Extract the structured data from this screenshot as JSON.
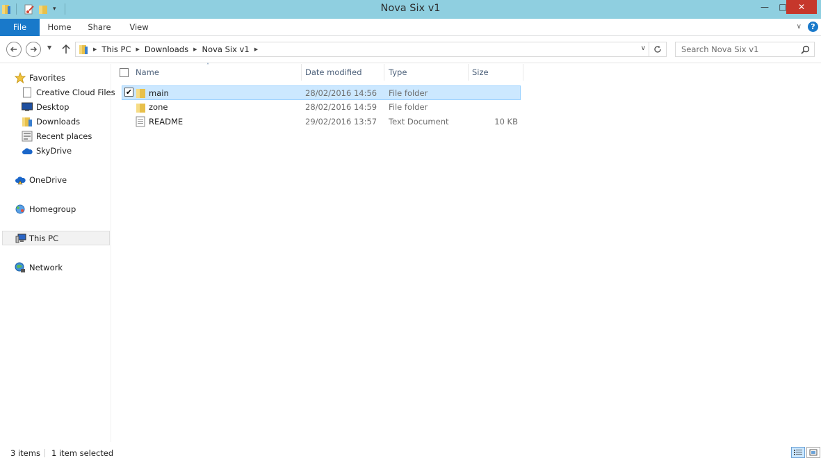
{
  "window": {
    "title": "Nova Six v1",
    "minimize_glyph": "—",
    "maximize_glyph": "□",
    "close_glyph": "✕"
  },
  "ribbon": {
    "tabs": [
      "File",
      "Home",
      "Share",
      "View"
    ],
    "help_glyph": "?"
  },
  "address": {
    "crumbs": [
      "This PC",
      "Downloads",
      "Nova Six v1"
    ],
    "search_placeholder": "Search Nova Six v1"
  },
  "nav": {
    "favorites": "Favorites",
    "favorites_items": [
      "Creative Cloud Files",
      "Desktop",
      "Downloads",
      "Recent places",
      "SkyDrive"
    ],
    "onedrive": "OneDrive",
    "homegroup": "Homegroup",
    "this_pc": "This PC",
    "network": "Network"
  },
  "columns": {
    "name": "Name",
    "date": "Date modified",
    "type": "Type",
    "size": "Size"
  },
  "files": [
    {
      "name": "main",
      "date": "28/02/2016 14:56",
      "type": "File folder",
      "size": "",
      "icon": "folder-icon",
      "selected": true
    },
    {
      "name": "zone",
      "date": "28/02/2016 14:59",
      "type": "File folder",
      "size": "",
      "icon": "folder-icon",
      "selected": false
    },
    {
      "name": "README",
      "date": "29/02/2016 13:57",
      "type": "Text Document",
      "size": "10 KB",
      "icon": "text-document-icon",
      "selected": false
    }
  ],
  "status": {
    "items": "3 items",
    "selected": "1 item selected"
  },
  "colors": {
    "titlebar": "#8fcfe0",
    "file_tab": "#1979ca",
    "selection": "#cce8ff",
    "close": "#c6372b"
  }
}
